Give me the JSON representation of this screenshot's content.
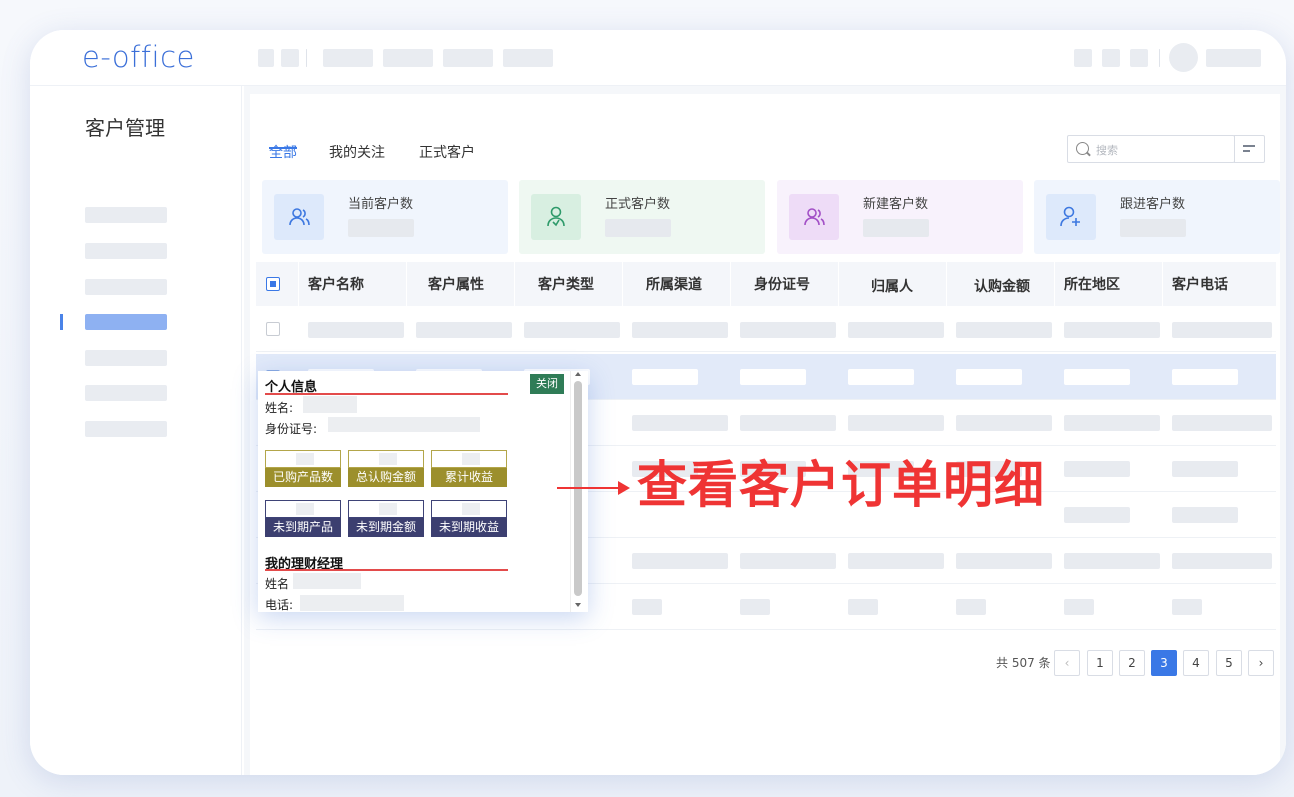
{
  "app": {
    "logo": "e-office"
  },
  "sidebar": {
    "title": "客户管理"
  },
  "tabs": [
    {
      "label": "全部",
      "active": true
    },
    {
      "label": "我的关注",
      "active": false
    },
    {
      "label": "正式客户",
      "active": false
    }
  ],
  "search": {
    "placeholder": "搜索"
  },
  "stats": [
    {
      "label": "当前客户数",
      "icon": "users-icon",
      "color": "#3d78e0",
      "bg": "#eef4fd"
    },
    {
      "label": "正式客户数",
      "icon": "user-check-icon",
      "color": "#2e9a6a",
      "bg": "#eef8f2"
    },
    {
      "label": "新建客户数",
      "icon": "users-new-icon",
      "color": "#a24fc6",
      "bg": "#f7f1fb"
    },
    {
      "label": "跟进客户数",
      "icon": "user-add-icon",
      "color": "#3d78e0",
      "bg": "#eef4fd"
    }
  ],
  "table": {
    "columns": [
      "客户名称",
      "客户属性",
      "客户类型",
      "所属渠道",
      "身份证号",
      "归属人",
      "认购金额",
      "所在地区",
      "客户电话"
    ]
  },
  "pagination": {
    "total_text": "共 507 条",
    "pages": [
      "1",
      "2",
      "3",
      "4",
      "5"
    ],
    "current": "3"
  },
  "popup": {
    "section1_title": "个人信息",
    "close_label": "关闭",
    "name_label": "姓名:",
    "id_label": "身份证号:",
    "tiles_row1": [
      "已购产品数",
      "总认购金额",
      "累计收益"
    ],
    "tiles_row2": [
      "未到期产品",
      "未到期金额",
      "未到期收益"
    ],
    "section2_title": "我的理财经理",
    "mgr_name_label": "姓名",
    "mgr_phone_label": "电话:"
  },
  "annotation": {
    "text": "查看客户订单明细"
  },
  "colors": {
    "accent": "#3a78e6",
    "annotation": "#ef3434",
    "gold": "#9c8f2c",
    "navy": "#3c3f70",
    "close": "#2f7c57"
  }
}
